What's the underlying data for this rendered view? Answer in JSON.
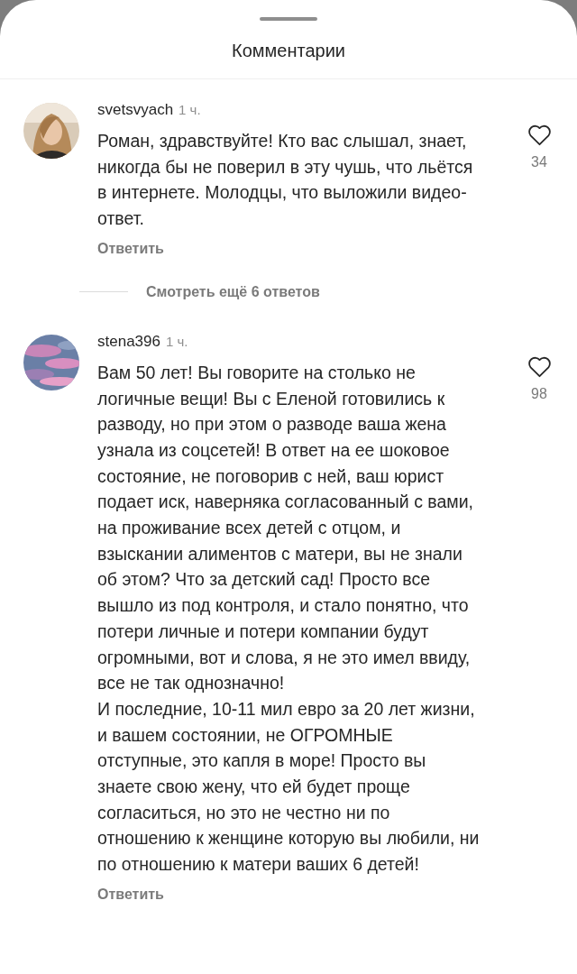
{
  "sheet": {
    "title": "Комментарии"
  },
  "comments": [
    {
      "kind": "picture",
      "username": "svetsvyach",
      "time": "1 ч.",
      "text": "Роман, здравствуйте! Кто вас слышал, знает, никогда бы не поверил в эту чушь, что льётся в интернете. Молодцы, что выложили видео-ответ.",
      "reply": "Ответить",
      "likes": "34",
      "liked": false,
      "more_replies": "Смотреть ещё 6 ответов"
    },
    {
      "kind": "sky",
      "username": "stena396",
      "time": "1 ч.",
      "text": "Вам 50 лет! Вы говорите на столько не логичные вещи! Вы с Еленой готовились к разводу, но при этом о разводе ваша жена узнала из соцсетей! В ответ на ее шоковое состояние, не поговорив с ней, ваш юрист подает иск, наверняка согласованный с вами, на проживание всех детей с отцом, и взыскании алиментов с матери, вы не знали об этом? Что за детский сад! Просто все вышло из под контроля, и стало понятно, что потери личные и потери компании будут огромными, вот и слова, я не это имел ввиду, все не так однозначно!\nИ последние, 10-11 мил евро за 20 лет жизни, и вашем состоянии, не ОГРОМНЫЕ отступные, это капля в море! Просто вы знаете свою жену, что ей будет проще согласиться, но это не честно ни по отношению к женщине которую вы любили, ни по отношению к матери ваших 6 детей!",
      "reply": "Ответить",
      "likes": "98",
      "liked": false
    }
  ]
}
